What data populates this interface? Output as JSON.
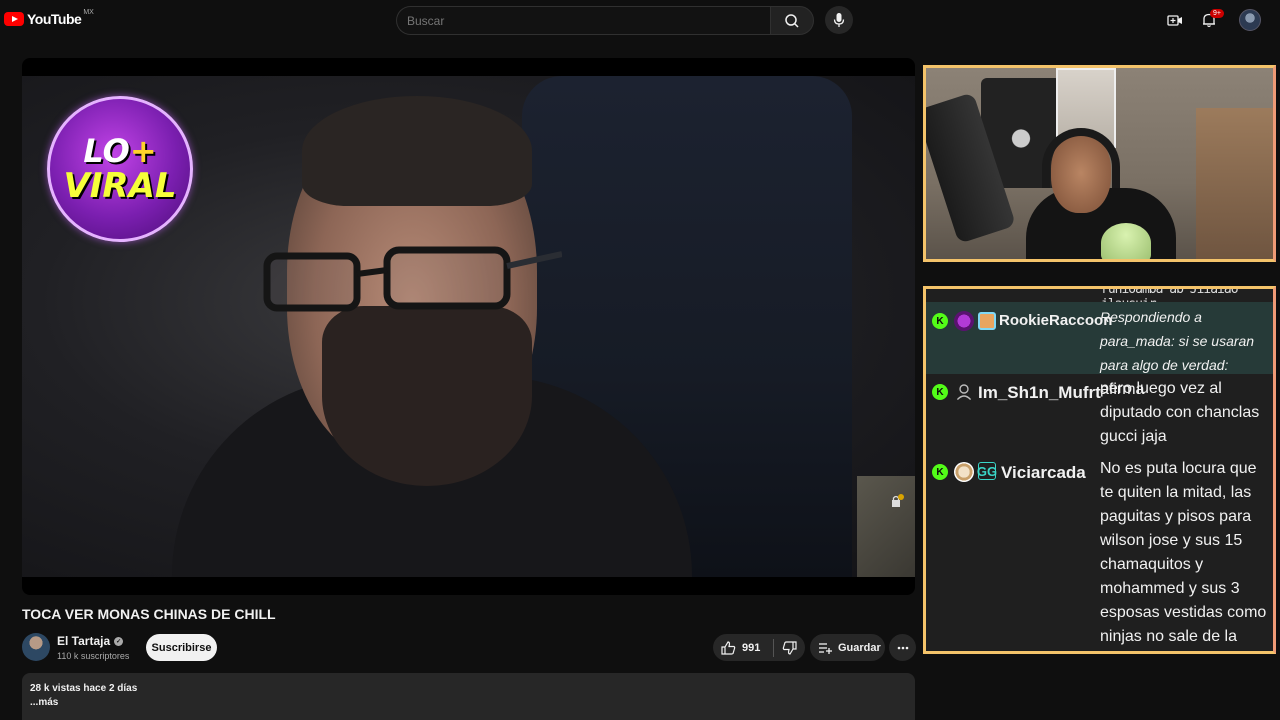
{
  "header": {
    "logo_text": "YouTube",
    "country": "MX",
    "search_placeholder": "Buscar",
    "notification_count": "9+"
  },
  "overlay": {
    "badge_line1_a": "LO",
    "badge_line1_b": "+",
    "badge_line2": "VIRAL"
  },
  "video": {
    "title": "TOCA VER MONAS CHINAS DE CHILL",
    "channel_name": "El Tartaja",
    "subscribers": "110 k suscriptores",
    "subscribe_label": "Suscribirse",
    "likes": "991",
    "save_label": "Guardar",
    "views_date": "28 k vistas  hace 2 días",
    "more_label": "...más"
  },
  "chat": {
    "top_cut_text": "ruhioamba ab Jiiaiao ilausuir",
    "messages": [
      {
        "username": "RookieRaccoon",
        "reply": "Respondiendo a para_mada: si se usaran para algo de verdad:",
        "text": "afirma",
        "highlight": true
      },
      {
        "username": "Im_Sh1n_Mufrt",
        "text": "pero luego vez al diputado con chanclas gucci jaja",
        "highlight": false
      },
      {
        "username": "Viciarcada",
        "text": "No es puta locura que te quiten la mitad, las paguitas y pisos para wilson jose y sus 15 chamaquitos y mohammed y sus 3 esposas vestidas como ninjas no sale de la nada.",
        "highlight": false
      }
    ]
  },
  "colors": {
    "brand_red": "#ff0000",
    "kick_green": "#53fc18",
    "frame_gold": "#f4c36a"
  }
}
